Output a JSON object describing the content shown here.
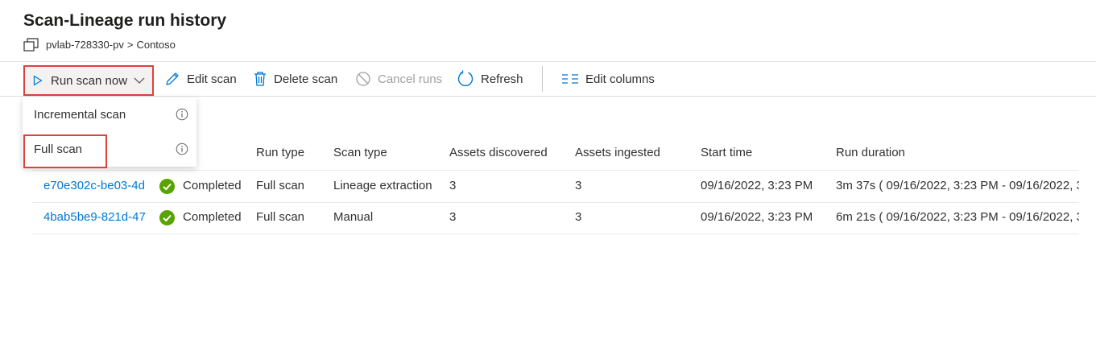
{
  "page": {
    "title": "Scan-Lineage run history",
    "breadcrumb": {
      "icon": "copy-icon",
      "parent": "pvlab-728330-pv",
      "separator": ">",
      "current": "Contoso"
    }
  },
  "toolbar": {
    "run_scan_now": "Run scan now",
    "edit_scan": "Edit scan",
    "delete_scan": "Delete scan",
    "cancel_runs": "Cancel runs",
    "refresh": "Refresh",
    "edit_columns": "Edit columns"
  },
  "dropdown": {
    "items": [
      {
        "label": "Incremental scan",
        "icon": "info-icon"
      },
      {
        "label": "Full scan",
        "icon": "info-icon"
      }
    ]
  },
  "table": {
    "columns": [
      "Run type",
      "Scan type",
      "Assets discovered",
      "Assets ingested",
      "Start time",
      "Run duration"
    ],
    "rows": [
      {
        "run_id": "e70e302c-be03-4d",
        "status": "Completed",
        "run_type": "Full scan",
        "scan_type": "Lineage extraction",
        "assets_discovered": "3",
        "assets_ingested": "3",
        "start_time": "09/16/2022, 3:23 PM",
        "run_duration": "3m 37s ( 09/16/2022, 3:23 PM - 09/16/2022, 3"
      },
      {
        "run_id": "4bab5be9-821d-47",
        "status": "Completed",
        "run_type": "Full scan",
        "scan_type": "Manual",
        "assets_discovered": "3",
        "assets_ingested": "3",
        "start_time": "09/16/2022, 3:23 PM",
        "run_duration": "6m 21s ( 09/16/2022, 3:23 PM - 09/16/2022, 3"
      }
    ]
  },
  "colors": {
    "accent": "#0078d4",
    "highlight": "#e03f3f",
    "success": "#57a300",
    "text": "#323130",
    "disabled": "#a19f9d"
  }
}
